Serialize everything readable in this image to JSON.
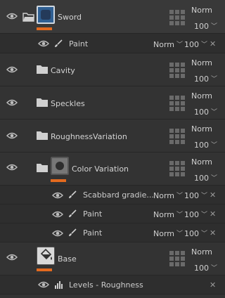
{
  "layers": [
    {
      "name": "Sword",
      "blend": "Norm",
      "opacity": "100"
    },
    {
      "name": "Paint",
      "blend": "Norm",
      "opacity": "100"
    },
    {
      "name": "Cavity",
      "blend": "Norm",
      "opacity": "100"
    },
    {
      "name": "Speckles",
      "blend": "Norm",
      "opacity": "100"
    },
    {
      "name": "RoughnessVariation",
      "blend": "Norm",
      "opacity": "100"
    },
    {
      "name": "Color Variation",
      "blend": "Norm",
      "opacity": "100"
    },
    {
      "name": "Scabbard gradie...",
      "blend": "Norm",
      "opacity": "100"
    },
    {
      "name": "Paint",
      "blend": "Norm",
      "opacity": "100"
    },
    {
      "name": "Paint",
      "blend": "Norm",
      "opacity": "100"
    },
    {
      "name": "Base",
      "blend": "Norm",
      "opacity": "100"
    },
    {
      "name": "Levels - Roughness"
    }
  ],
  "colors": {
    "accent": "#e36a1f",
    "panel": "#333333",
    "text": "#d4d4d4"
  },
  "icons": {
    "visibility": "eye-icon",
    "folder": "folder-icon",
    "brush": "brush-icon",
    "levels": "levels-icon",
    "close": "close-icon",
    "mask": "mask-grid-icon"
  }
}
